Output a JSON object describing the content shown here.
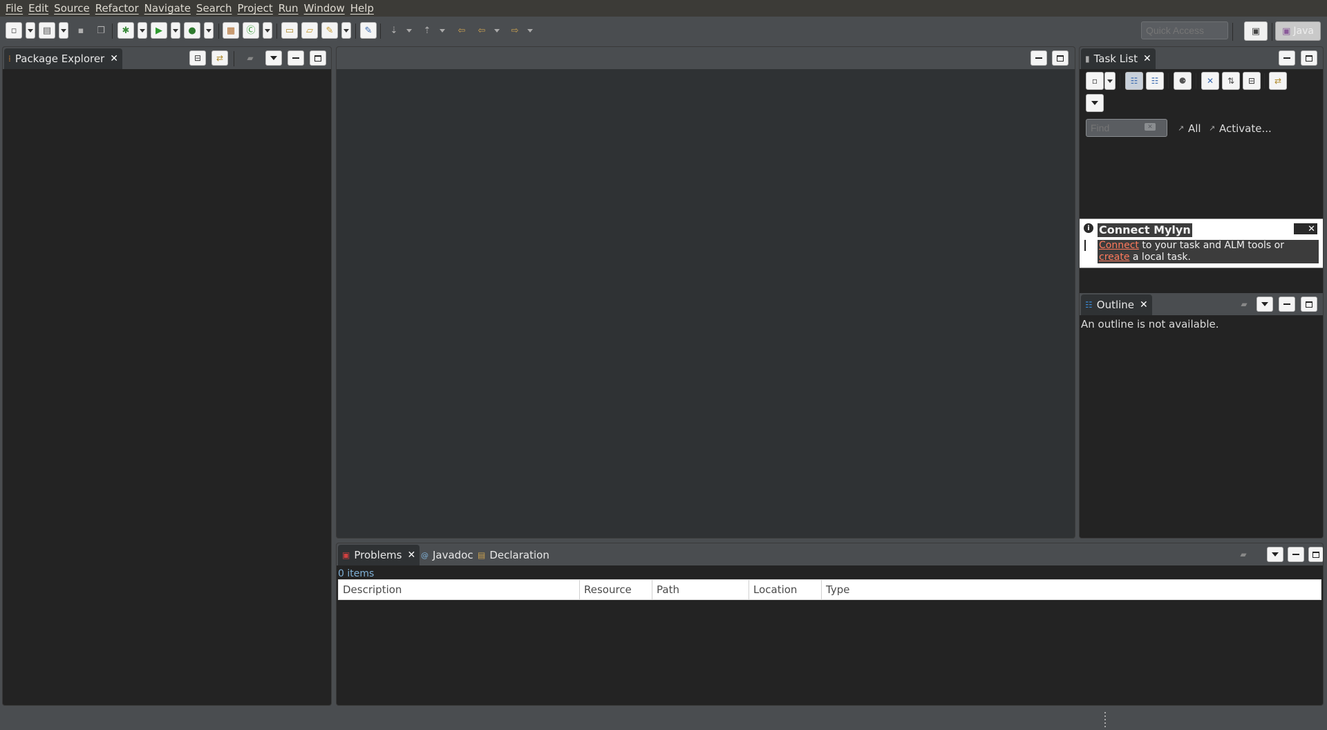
{
  "menu": [
    "File",
    "Edit",
    "Source",
    "Refactor",
    "Navigate",
    "Search",
    "Project",
    "Run",
    "Window",
    "Help"
  ],
  "toolbar": {
    "quick_access_placeholder": "Quick Access",
    "perspective_label": "Java"
  },
  "package_explorer": {
    "title": "Package Explorer"
  },
  "task_list": {
    "title": "Task List",
    "find_placeholder": "Find",
    "filter_all": "All",
    "activate": "Activate..."
  },
  "mylyn": {
    "title": "Connect Mylyn",
    "link_connect": "Connect",
    "text_middle": " to your task and ALM tools or ",
    "link_create": "create",
    "text_end": " a local task."
  },
  "outline": {
    "title": "Outline",
    "message": "An outline is not available."
  },
  "bottom": {
    "tabs": [
      "Problems",
      "Javadoc",
      "Declaration"
    ],
    "item_count": "0 items",
    "columns": [
      "Description",
      "Resource",
      "Path",
      "Location",
      "Type"
    ]
  },
  "colors": {
    "accent_link": "#ff7a5c",
    "panel_bg": "#232323",
    "editor_bg": "#2f3234",
    "chrome_bg": "#4a4d50"
  }
}
